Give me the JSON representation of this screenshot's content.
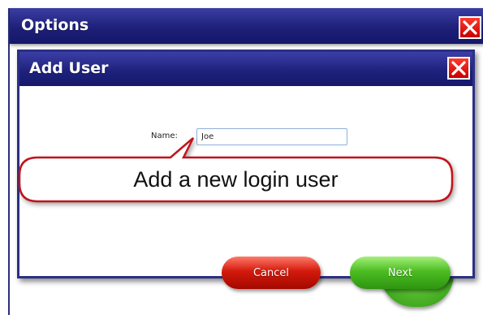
{
  "options_window": {
    "title": "Options"
  },
  "add_user_dialog": {
    "title": "Add User",
    "name_label": "Name:",
    "name_value": "Joe",
    "cancel_label": "Cancel",
    "next_label": "Next"
  },
  "callout": {
    "text": "Add a new login user"
  },
  "colors": {
    "titlebar": "#1e2079",
    "close_red": "#e00000",
    "callout_border": "#c0141c",
    "cancel_red": "#c41208",
    "next_green": "#4cbc22"
  },
  "icons": {
    "close": "close-icon"
  }
}
